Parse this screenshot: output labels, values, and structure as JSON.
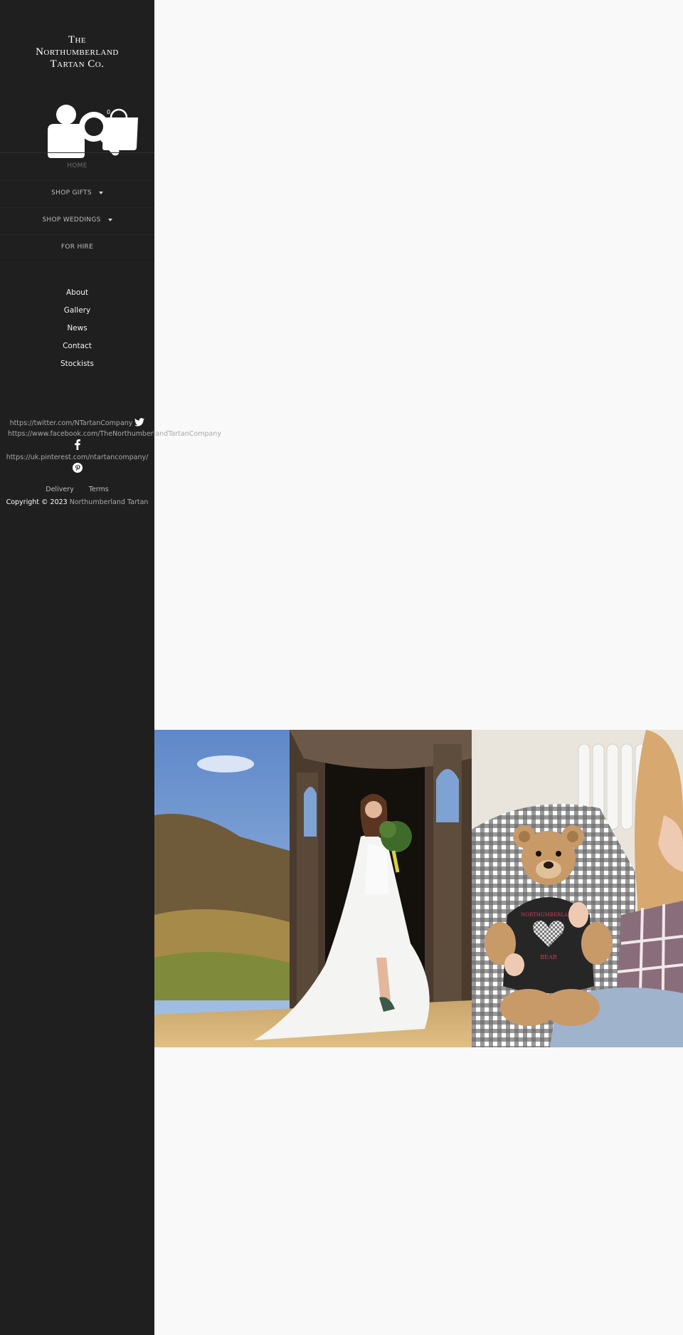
{
  "brand": {
    "logo_lines": [
      "The",
      "Northumberland",
      "Tartan Co."
    ]
  },
  "header_icons": [
    "user-icon",
    "search-icon",
    "shopping-bag-icon"
  ],
  "cart": {
    "count": "0"
  },
  "main_nav": [
    {
      "label": "HOME",
      "active": true,
      "dropdown": false
    },
    {
      "label": "SHOP GIFTS",
      "active": false,
      "dropdown": true
    },
    {
      "label": "SHOP WEDDINGS",
      "active": false,
      "dropdown": true
    },
    {
      "label": "FOR HIRE",
      "active": false,
      "dropdown": false
    }
  ],
  "secondary_nav": [
    "About",
    "Gallery",
    "News",
    "Contact",
    "Stockists"
  ],
  "social": {
    "twitter": {
      "url": "https://twitter.com/NTartanCompany",
      "icon": "twitter-icon"
    },
    "facebook": {
      "url": "https://www.facebook.com/TheNorthumberlandTartanCompany",
      "icon": "facebook-icon"
    },
    "pinterest": {
      "url": "https://uk.pinterest.com/ntartancompany/",
      "icon": "pinterest-icon"
    }
  },
  "footer": {
    "links": [
      "Delivery",
      "Terms"
    ],
    "copyright_prefix": "Copyright © 2023",
    "copyright_name": "Northumberland Tartan"
  },
  "colors": {
    "sidebar_bg": "#1f1f1f",
    "page_bg": "#f9f9f9",
    "nav_text": "#bdbdbd",
    "nav_active": "#6e6e6e"
  },
  "hero": {
    "images": [
      "bride-photo",
      "teddy-bear-photo"
    ],
    "bear_shirt_text_top": "NORTHUMBERLAND",
    "bear_shirt_text_bottom": "BEAR"
  }
}
